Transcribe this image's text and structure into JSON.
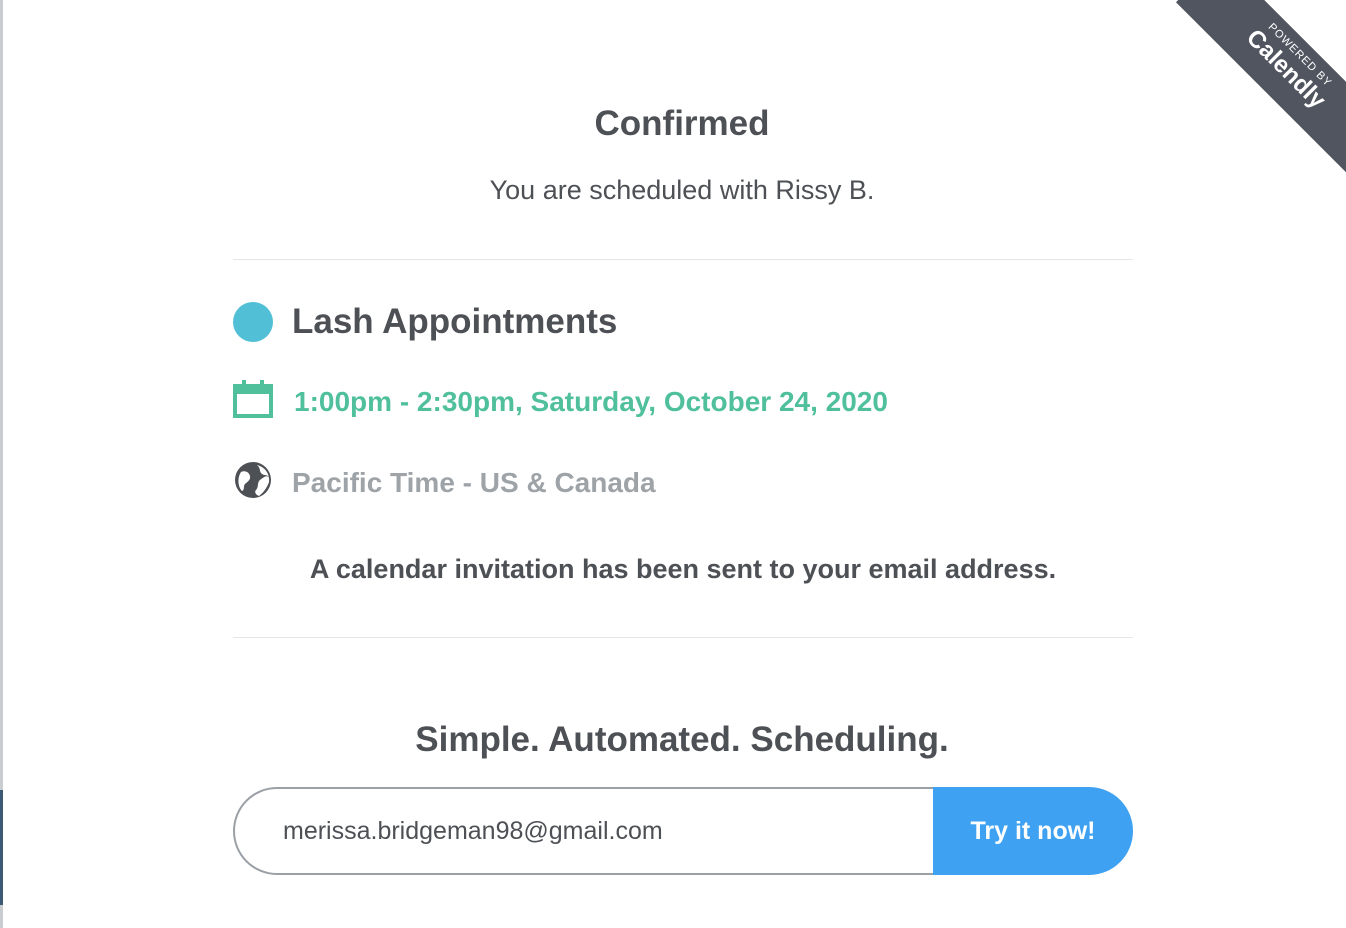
{
  "badge": {
    "powered_by": "POWERED BY",
    "brand": "Calendly"
  },
  "confirmation": {
    "title": "Confirmed",
    "subtitle": "You are scheduled with Rissy B."
  },
  "event": {
    "name": "Lash Appointments",
    "color": "#51bfd5",
    "datetime": "1:00pm - 2:30pm, Saturday, October 24, 2020",
    "datetime_color": "#4fbf9c",
    "timezone": "Pacific Time - US & Canada",
    "icons": {
      "date": "calendar-icon",
      "timezone": "globe-icon"
    }
  },
  "notice": "A calendar invitation has been sent to your email address.",
  "promo": {
    "tagline": "Simple. Automated. Scheduling.",
    "email_value": "merissa.bridgeman98@gmail.com",
    "button_label": "Try it now!",
    "button_color": "#3ea1f2"
  }
}
